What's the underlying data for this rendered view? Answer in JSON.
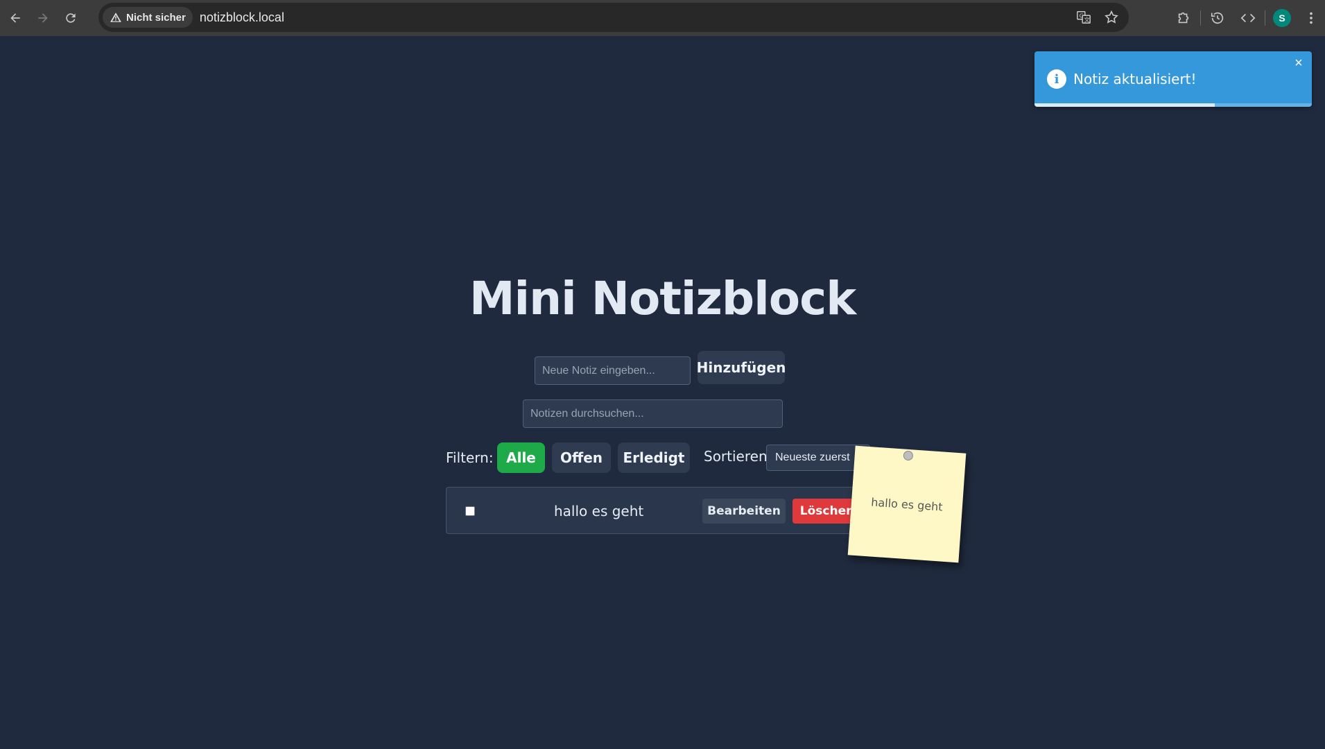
{
  "browser": {
    "security_label": "Nicht sicher",
    "url": "notizblock.local",
    "profile_initial": "S"
  },
  "app": {
    "title": "Mini Notizblock",
    "new_note_placeholder": "Neue Notiz eingeben...",
    "add_label": "Hinzufügen",
    "search_placeholder": "Notizen durchsuchen...",
    "filter_label": "Filtern:",
    "filters": [
      {
        "label": "Alle",
        "active": true
      },
      {
        "label": "Offen",
        "active": false
      },
      {
        "label": "Erledigt",
        "active": false
      }
    ],
    "sort_label": "Sortieren:",
    "sort_value": "Neueste zuerst"
  },
  "notes": [
    {
      "text": "hallo es geht",
      "done": false,
      "edit_label": "Bearbeiten",
      "delete_label": "Löschen"
    }
  ],
  "sticky": {
    "text": "hallo es geht"
  },
  "toast": {
    "message": "Notiz aktualisiert!",
    "close_glyph": "×",
    "info_glyph": "i",
    "progress": 0.65,
    "color": "#3498db"
  },
  "colors": {
    "background": "#1f2a3e",
    "active_filter": "#1faa4a",
    "delete": "#e0393b",
    "sticky": "#fdf8c6"
  }
}
